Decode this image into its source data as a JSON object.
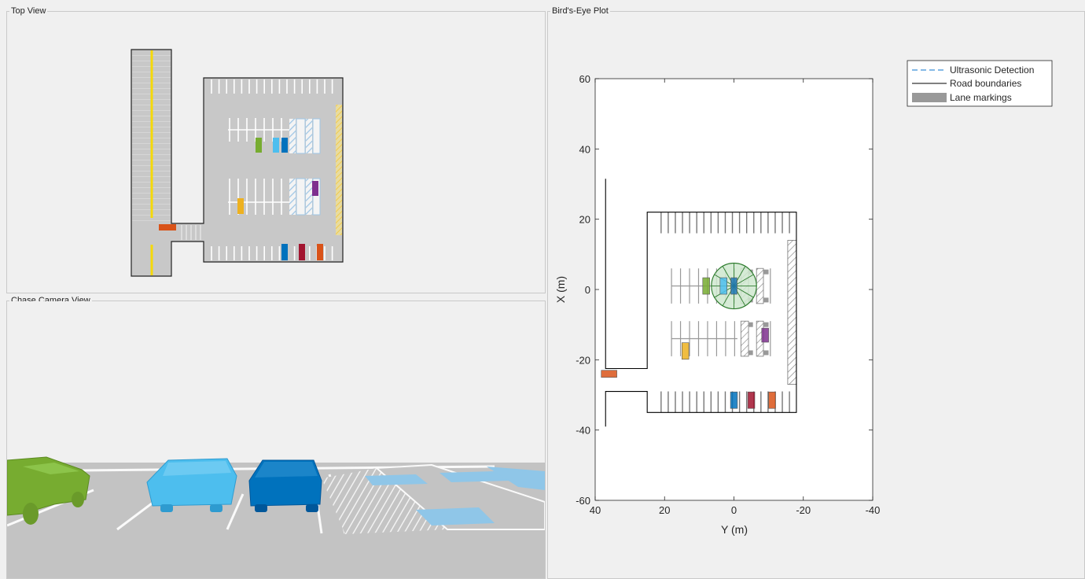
{
  "panels": {
    "top_view": {
      "title": "Top View"
    },
    "chase_view": {
      "title": "Chase Camera View"
    },
    "birds_eye": {
      "title": "Bird's-Eye Plot"
    }
  },
  "chart_data": {
    "type": "scatter",
    "title": "",
    "xlabel": "Y (m)",
    "ylabel": "X (m)",
    "xlim": [
      40,
      -40
    ],
    "ylim": [
      -60,
      60
    ],
    "xticks": [
      40,
      20,
      0,
      -20,
      -40
    ],
    "yticks": [
      60,
      40,
      20,
      0,
      -20,
      -40,
      -60
    ],
    "grid": false,
    "legend": {
      "placement": "top-right-outside",
      "entries": [
        {
          "label": "Ultrasonic Detection",
          "style": "dashed",
          "color": "#3a8fd6"
        },
        {
          "label": "Road boundaries",
          "style": "solid",
          "color": "#000000"
        },
        {
          "label": "Lane markings",
          "style": "patch",
          "color": "#999999"
        }
      ]
    },
    "road_boundaries": [
      [
        [
          37,
          31.5
        ],
        [
          37,
          -22.5
        ],
        [
          25,
          -22.5
        ],
        [
          25,
          22
        ],
        [
          -18,
          22
        ],
        [
          -18,
          -35
        ],
        [
          25,
          -35
        ],
        [
          25,
          -29
        ],
        [
          37,
          -29
        ],
        [
          37,
          -39
        ]
      ]
    ],
    "top_stall_lines": {
      "y_range": [
        21,
        -16
      ],
      "x_top": 22,
      "x_bottom": 16,
      "count": 19
    },
    "bottom_stall_lines": {
      "y_range": [
        21,
        -16
      ],
      "x_top": -29,
      "x_bottom": -35,
      "count": 19
    },
    "hatched_strip": {
      "y": [
        -15.5,
        -18
      ],
      "x": [
        14,
        -27
      ]
    },
    "vehicles": [
      {
        "name": "ego",
        "y": 0,
        "x": 1,
        "length": 4.7,
        "width": 1.8,
        "color": "#1f77b4"
      },
      {
        "name": "parked-green",
        "y": 8,
        "x": 1,
        "length": 4.7,
        "width": 2,
        "color": "#77ac30"
      },
      {
        "name": "parked-light-blue",
        "y": 3,
        "x": 1,
        "length": 4.7,
        "width": 2,
        "color": "#4dbeee"
      },
      {
        "name": "parked-purple",
        "y": -9,
        "x": -13,
        "length": 4,
        "width": 2,
        "color": "#7e2f8e"
      },
      {
        "name": "parked-yellow",
        "y": 14,
        "x": -17.5,
        "length": 4.7,
        "width": 2,
        "color": "#edb120"
      },
      {
        "name": "parked-blue",
        "y": 0,
        "x": -31.5,
        "length": 4.7,
        "width": 2,
        "color": "#0072bd"
      },
      {
        "name": "parked-red",
        "y": -5,
        "x": -31.5,
        "length": 4.7,
        "width": 2,
        "color": "#a2142f"
      },
      {
        "name": "parked-orange",
        "y": -11,
        "x": -31.5,
        "length": 4.7,
        "width": 2,
        "color": "#d95319"
      },
      {
        "name": "moving-orange",
        "y": 36,
        "x": -24,
        "length": 2,
        "width": 4.5,
        "color": "#d95319"
      }
    ],
    "sensor_coverage": {
      "center_y": 0,
      "center_x": 1,
      "radius": 6.5,
      "rays": 12,
      "color": "#7fbf7f"
    }
  }
}
